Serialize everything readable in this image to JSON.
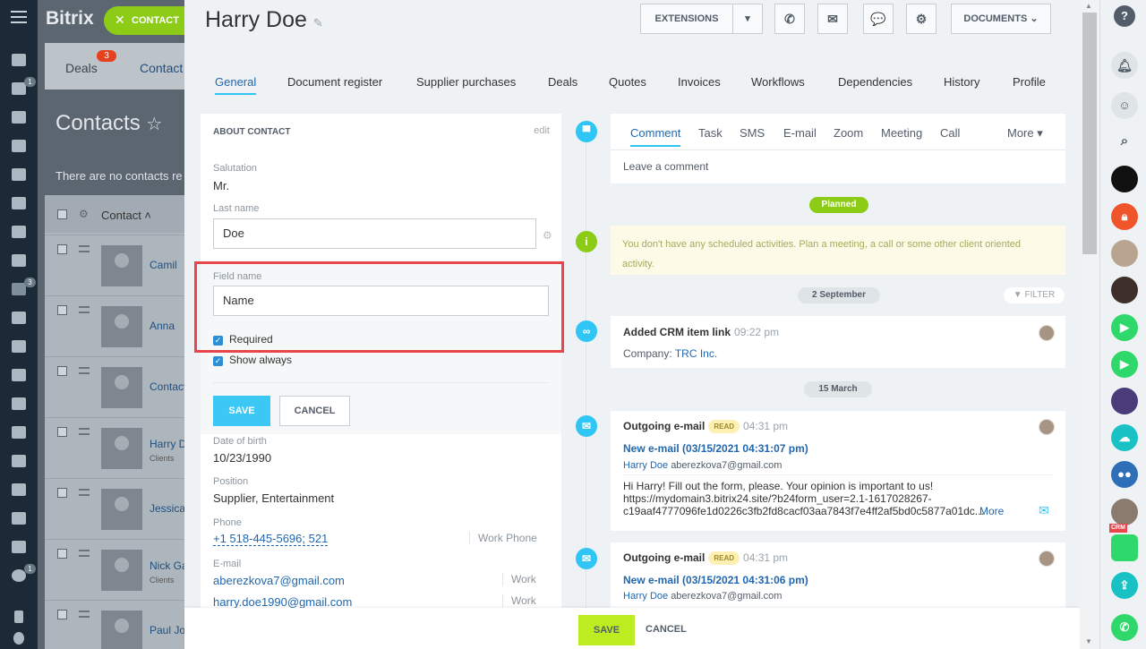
{
  "background": {
    "brand": "Bitrix",
    "tabs": [
      {
        "label": "Deals",
        "badge": "3"
      },
      {
        "label": "Contact"
      }
    ],
    "title": "Contacts",
    "note": "There are no contacts re",
    "list_header": "Contact",
    "rows": [
      {
        "name": "Camil",
        "sub": ""
      },
      {
        "name": "Anna",
        "sub": ""
      },
      {
        "name": "Contact",
        "sub": ""
      },
      {
        "name": "Harry D",
        "sub": "Clients"
      },
      {
        "name": "Jessica",
        "sub": ""
      },
      {
        "name": "Nick Ga",
        "sub": "Clients"
      },
      {
        "name": "Paul Jo",
        "sub": ""
      }
    ]
  },
  "leftbar": {
    "badges": [
      "1",
      "3",
      "1"
    ]
  },
  "chip": {
    "close": "✕",
    "label": "CONTACT"
  },
  "header": {
    "name": "Harry  Doe",
    "pen": "✎",
    "extensions": "EXTENSIONS",
    "caret": "▾",
    "documents": "DOCUMENTS ⌄",
    "icons": {
      "phone": "✆",
      "mail": "✉",
      "chat": "💬",
      "gear": "⚙"
    }
  },
  "tabs": [
    "General",
    "Document register",
    "Supplier purchases",
    "Deals",
    "Quotes",
    "Invoices",
    "Workflows",
    "Dependencies",
    "History",
    "Profile"
  ],
  "about": {
    "title": "ABOUT CONTACT",
    "edit": "edit",
    "salutation_label": "Salutation",
    "salutation": "Mr.",
    "lastname_label": "Last name",
    "lastname": "Doe",
    "fieldname_label": "Field name",
    "fieldname": "Name",
    "required": "Required",
    "show_always": "Show always",
    "save": "SAVE",
    "cancel": "CANCEL",
    "dob_label": "Date of birth",
    "dob": "10/23/1990",
    "position_label": "Position",
    "position": "Supplier, Entertainment",
    "phone_label": "Phone",
    "phone": "+1 518-445-5696; 521",
    "phone_type": "Work Phone",
    "email_label": "E-mail",
    "email1": "aberezkova7@gmail.com",
    "email1_type": "Work",
    "email2": "harry.doe1990@gmail.com",
    "email2_type": "Work"
  },
  "timeline": {
    "tabs": [
      "Comment",
      "Task",
      "SMS",
      "E-mail",
      "Zoom",
      "Meeting",
      "Call",
      "More ▾"
    ],
    "comment_placeholder": "Leave a comment",
    "planned": "Planned",
    "empty_note": "You don't have any scheduled activities. Plan a meeting, a call or some other client oriented activity.",
    "date1": "2 September",
    "filter": "FILTER",
    "link_title": "Added CRM item link",
    "link_time": "09:22 pm",
    "link_company_label": "Company:",
    "link_company": "TRC Inc.",
    "date2": "15 March",
    "email1": {
      "title": "Outgoing e-mail",
      "badge": "READ",
      "time": "04:31 pm",
      "subject": "New e-mail (03/15/2021 04:31:07 pm)",
      "from_name": "Harry Doe",
      "from_email": "aberezkova7@gmail.com",
      "body1": "Hi Harry! Fill out the form, please. Your opinion is important to us!",
      "body2": "https://mydomain3.bitrix24.site/?b24form_user=2.1-1617028267-",
      "body3": "c19aaf4777096fe1d0226c3fb2fd8cacf03aa7843f7e4ff2af5bd0c5877a01dc...",
      "more": "More"
    },
    "email2": {
      "title": "Outgoing e-mail",
      "badge": "READ",
      "time": "04:31 pm",
      "subject": "New e-mail (03/15/2021 04:31:06 pm)",
      "from_name": "Harry Doe",
      "from_email": "aberezkova7@gmail.com"
    }
  },
  "bottombar": {
    "save": "SAVE",
    "cancel": "CANCEL"
  },
  "rightbar": {
    "help": "?",
    "crm": "CRM"
  },
  "colors": {
    "accent": "#2fc6f6",
    "lime": "#8ccc17",
    "link": "#2067b0",
    "highlight": "#e8464b",
    "save_green": "#bbed21"
  }
}
